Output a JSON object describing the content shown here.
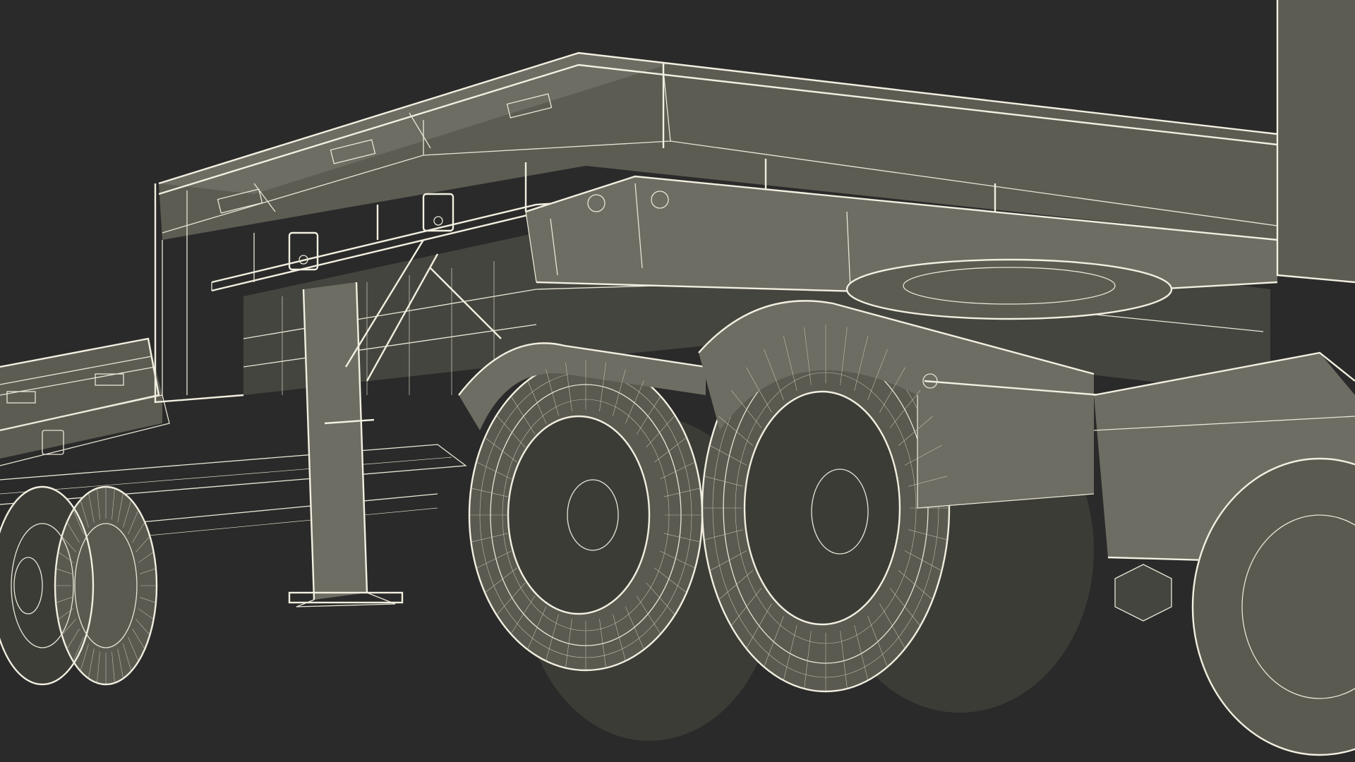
{
  "scene": {
    "subject": "trailer-wireframe-render",
    "colors": {
      "background": "#2a2a2a",
      "body": "#5c5c53",
      "wire": "#e9e6d6"
    }
  }
}
